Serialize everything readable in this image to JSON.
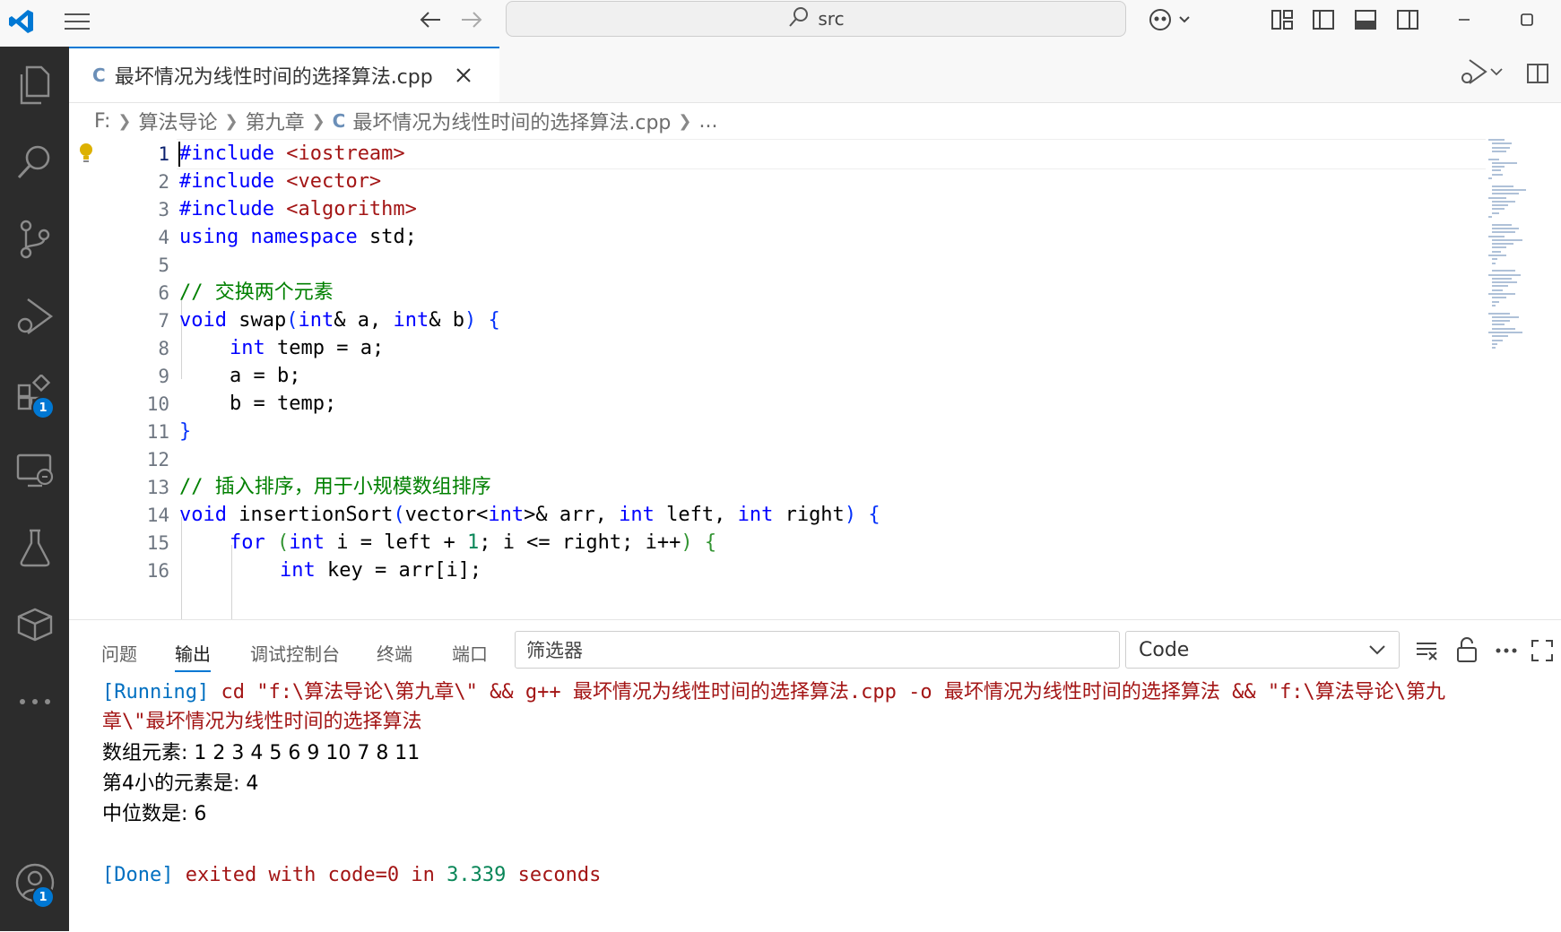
{
  "titlebar": {
    "search_text": "src",
    "colors": {
      "accent": "#0078d4",
      "logo": "#0078d4"
    }
  },
  "activity": {
    "extensions_badge": "1",
    "accounts_badge": "1"
  },
  "tab": {
    "file_icon": "C",
    "title": "最坏情况为线性时间的选择算法.cpp"
  },
  "breadcrumb": {
    "drive": "F:",
    "folder1": "算法导论",
    "folder2": "第九章",
    "file_icon": "C",
    "file": "最坏情况为线性时间的选择算法.cpp",
    "more": "..."
  },
  "code": {
    "line_numbers": [
      "1",
      "2",
      "3",
      "4",
      "5",
      "6",
      "7",
      "8",
      "9",
      "10",
      "11",
      "12",
      "13",
      "14",
      "15",
      "16"
    ],
    "l1": [
      "#include",
      " ",
      "<iostream>"
    ],
    "l2": [
      "#include",
      " ",
      "<vector>"
    ],
    "l3": [
      "#include",
      " ",
      "<algorithm>"
    ],
    "l4": [
      "using",
      " ",
      "namespace",
      " std;"
    ],
    "l6": "// 交换两个元素",
    "l7": [
      "void",
      " swap",
      "(",
      "int",
      "& a, ",
      "int",
      "& b",
      ")",
      " ",
      "{"
    ],
    "l8": [
      "int",
      " temp = a;"
    ],
    "l9": "a = b;",
    "l10": "b = temp;",
    "l11": "}",
    "l13": "// 插入排序，用于小规模数组排序",
    "l14": [
      "void",
      " insertionSort",
      "(",
      "vector<",
      "int",
      ">& arr, ",
      "int",
      " left, ",
      "int",
      " right",
      ")",
      " ",
      "{"
    ],
    "l15": [
      "for",
      " ",
      "(",
      "int",
      " i = left + ",
      "1",
      "; i <= right; i++",
      ")",
      " ",
      "{"
    ],
    "l16": [
      "int",
      " key = arr[i];"
    ]
  },
  "panel": {
    "tabs": [
      "问题",
      "输出",
      "调试控制台",
      "终端",
      "端口"
    ],
    "filter_placeholder": "筛选器",
    "channel": "Code",
    "output": {
      "run_tag": "[Running]",
      "run_cmd1": " cd \"f:\\算法导论\\第九章\\\" && g++ 最坏情况为线性时间的选择算法.cpp -o 最坏情况为线性时间的选择算法 && \"f:\\算法导论\\第九",
      "run_cmd2": "章\\\"最坏情况为线性时间的选择算法",
      "line1": "数组元素: 1 2 3 4 5 6 9 10 7 8 11",
      "line2": "第4小的元素是: 4",
      "line3": "中位数是: 6",
      "done_tag": "[Done]",
      "done_text1": " exited with ",
      "done_code": "code=0",
      "done_text2": " in ",
      "done_time": "3.339",
      "done_text3": " seconds"
    }
  }
}
